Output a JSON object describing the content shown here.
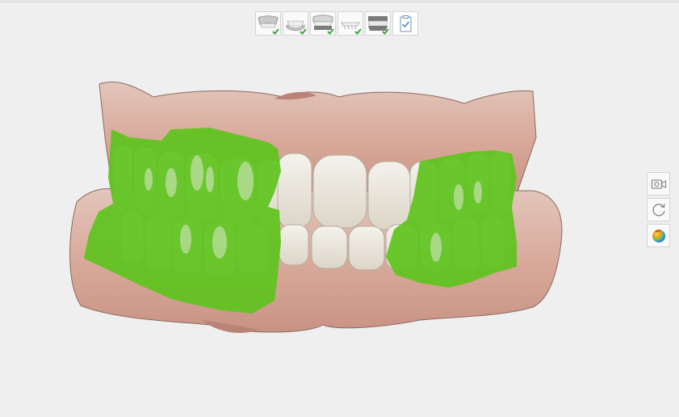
{
  "workflow_steps": [
    {
      "icon": "upper-jaw-scan-icon",
      "completed": true
    },
    {
      "icon": "lower-jaw-scan-icon",
      "completed": true
    },
    {
      "icon": "upper-arch-scan-icon",
      "completed": true
    },
    {
      "icon": "lower-arch-scan-icon",
      "completed": true
    },
    {
      "icon": "bite-scan-icon",
      "completed": true
    },
    {
      "icon": "clipboard-check-icon",
      "completed": false
    }
  ],
  "side_tools": [
    {
      "icon": "camera-icon"
    },
    {
      "icon": "rotate-icon"
    },
    {
      "icon": "color-map-icon"
    }
  ],
  "colors": {
    "background": "#efefef",
    "check_green": "#3aa935",
    "overlay_green": "#5fc41e",
    "gingiva": "#d9b0a3",
    "teeth": "#f1eee6"
  }
}
